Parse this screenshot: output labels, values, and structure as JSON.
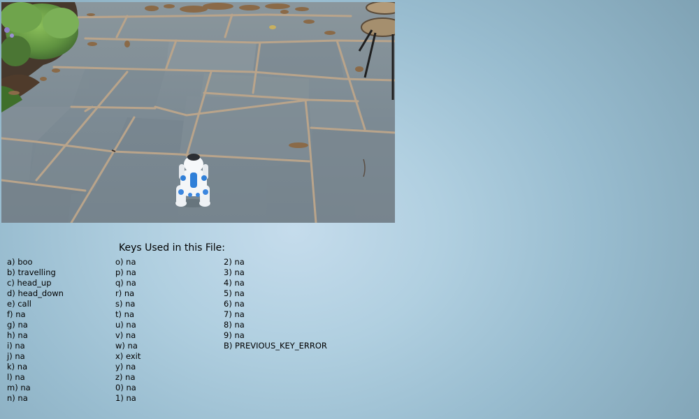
{
  "keys": {
    "title": "Keys Used in this File:",
    "columns": [
      [
        "a) boo",
        "b) travelling",
        "c) head_up",
        "d) head_down",
        "e) call",
        "f) na",
        "g) na",
        "h) na",
        "i) na",
        "j) na",
        "k) na",
        "l) na",
        "m) na",
        "n) na"
      ],
      [
        "o) na",
        "p) na",
        "q) na",
        "r) na",
        "s) na",
        "t) na",
        "u) na",
        "v) na",
        "w) na",
        "x) exit",
        "y) na",
        "z) na",
        "0) na",
        "1) na"
      ],
      [
        "2) na",
        "3) na",
        "4) na",
        "5) na",
        "6) na",
        "7) na",
        "8) na",
        "9) na",
        "B) PREVIOUS_KEY_ERROR"
      ]
    ]
  },
  "frame": {
    "subject": "white and blue robot dog on stone patio",
    "colors": {
      "paving": "#7f8d96",
      "grout": "#b59f86",
      "robot_body": "#f2f4f6",
      "robot_accent": "#2f7fd8"
    }
  }
}
